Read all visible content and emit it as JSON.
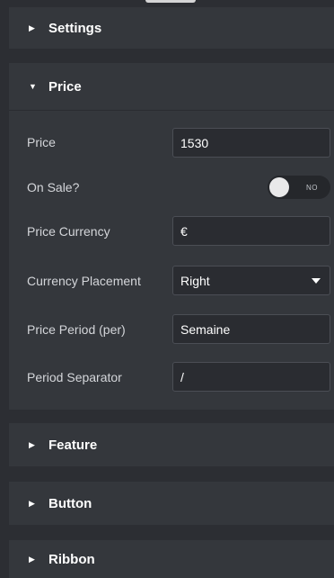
{
  "sections": {
    "settings": {
      "title": "Settings",
      "expanded": false
    },
    "price": {
      "title": "Price",
      "expanded": true
    },
    "feature": {
      "title": "Feature",
      "expanded": false
    },
    "button": {
      "title": "Button",
      "expanded": false
    },
    "ribbon": {
      "title": "Ribbon",
      "expanded": false
    }
  },
  "price_fields": {
    "price": {
      "label": "Price",
      "value": "1530"
    },
    "on_sale": {
      "label": "On Sale?",
      "toggle_text": "NO",
      "checked": false
    },
    "price_currency": {
      "label": "Price Currency",
      "value": "€"
    },
    "currency_placement": {
      "label": "Currency Placement",
      "value": "Right"
    },
    "price_period": {
      "label": "Price Period (per)",
      "value": "Semaine"
    },
    "period_separator": {
      "label": "Period Separator",
      "value": "/"
    }
  },
  "icons": {
    "collapsed": "caret-right-icon",
    "expanded": "caret-down-icon",
    "select": "chevron-down-icon"
  },
  "colors": {
    "background": "#2c2e33",
    "panel": "#34373c",
    "input": "#2a2c31",
    "text": "#ffffff"
  }
}
